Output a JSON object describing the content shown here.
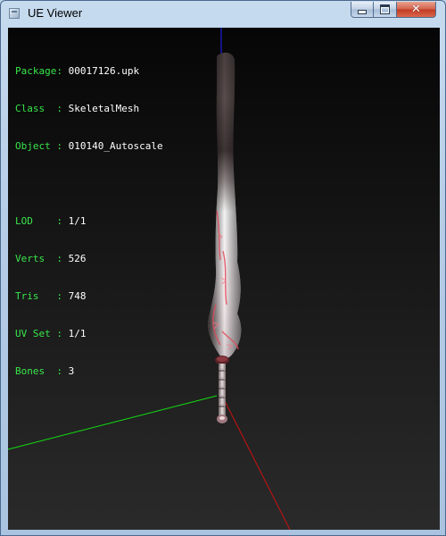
{
  "window": {
    "title": "UE Viewer",
    "icon": "app-window-icon",
    "controls": {
      "minimize": "minimize-icon",
      "maximize": "maximize-icon",
      "close_glyph": "✕"
    }
  },
  "info": {
    "package": {
      "label": "Package: ",
      "value": "00017126.upk"
    },
    "class": {
      "label": "Class  : ",
      "value": "SkeletalMesh"
    },
    "object": {
      "label": "Object : ",
      "value": "010140_Autoscale"
    },
    "lod": {
      "label": "LOD    : ",
      "value": "1/1"
    },
    "verts": {
      "label": "Verts  : ",
      "value": "526"
    },
    "tris": {
      "label": "Tris   : ",
      "value": "748"
    },
    "uvset": {
      "label": "UV Set : ",
      "value": "1/1"
    },
    "bones": {
      "label": "Bones  : ",
      "value": "3"
    }
  },
  "colors": {
    "label": "#38e64a",
    "value": "#ffffff",
    "axis_x": "#cc1111",
    "axis_y": "#11dd11",
    "axis_z": "#2222ff"
  }
}
